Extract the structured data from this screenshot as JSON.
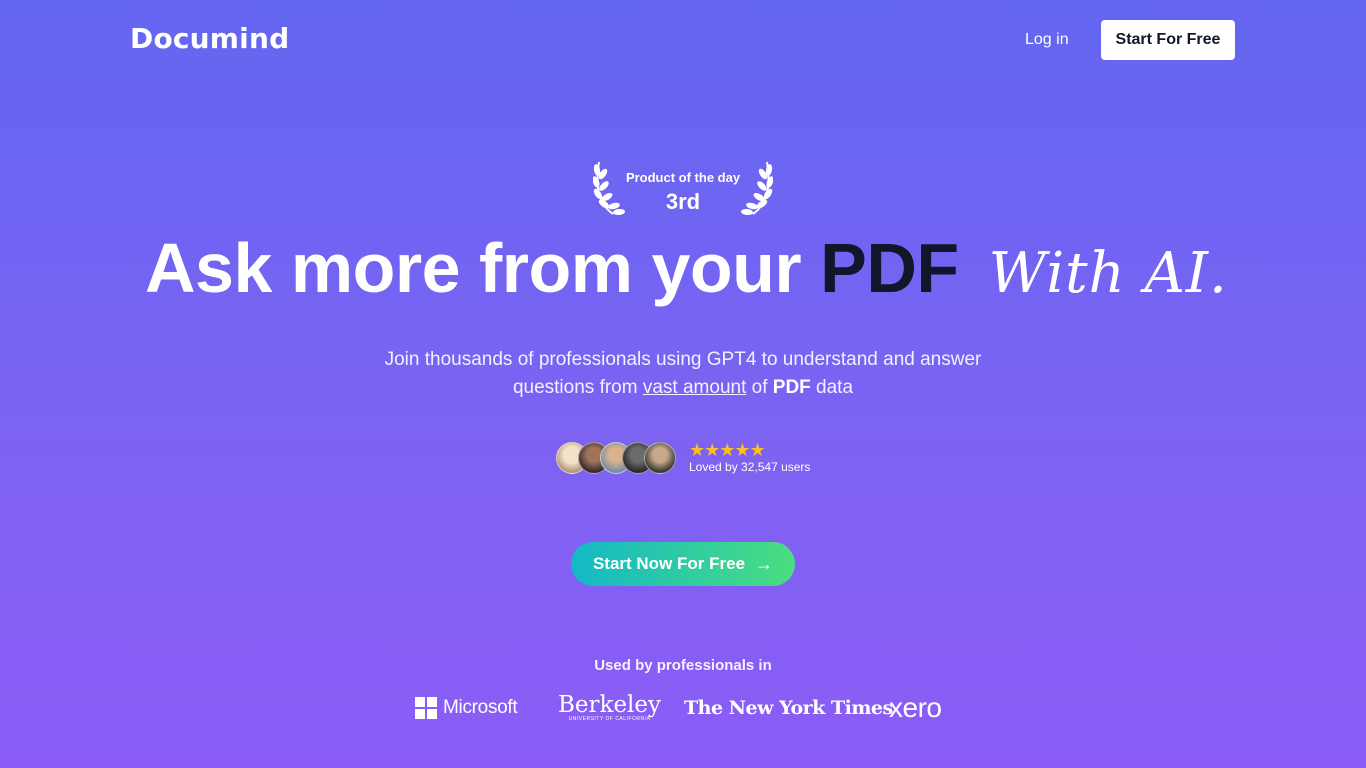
{
  "nav": {
    "logo": "Documind",
    "login_label": "Log in",
    "start_label": "Start For Free"
  },
  "award": {
    "label": "Product of the day",
    "rank": "3rd"
  },
  "hero": {
    "headline_main": "Ask more from your ",
    "headline_pdf": "PDF",
    "headline_ai": "With AI.",
    "sub_line1": "Join thousands of professionals using GPT4 to understand and answer",
    "sub_questions": "questions from ",
    "sub_vast": "vast amount",
    "sub_of": " of ",
    "sub_pdf": "PDF",
    "sub_data": " data"
  },
  "social_proof": {
    "stars": "★★★★★",
    "rating_stars": 5,
    "loved_text": "Loved by 32,547 users"
  },
  "cta": {
    "label": "Start Now For Free",
    "arrow": "→"
  },
  "used_by": {
    "title": "Used by professionals in",
    "logos": {
      "microsoft": "Microsoft",
      "berkeley": "Berkeley",
      "berkeley_sub": "UNIVERSITY OF CALIFORNIA",
      "nyt": "The New York Times",
      "xero": "xero"
    }
  },
  "colors": {
    "bg_top": "#6366f1",
    "bg_bottom": "#8b5cf6",
    "pdf_dark": "#0f172a",
    "star": "#fbbf24",
    "cta_start": "#14b8c6",
    "cta_end": "#4ade80"
  }
}
